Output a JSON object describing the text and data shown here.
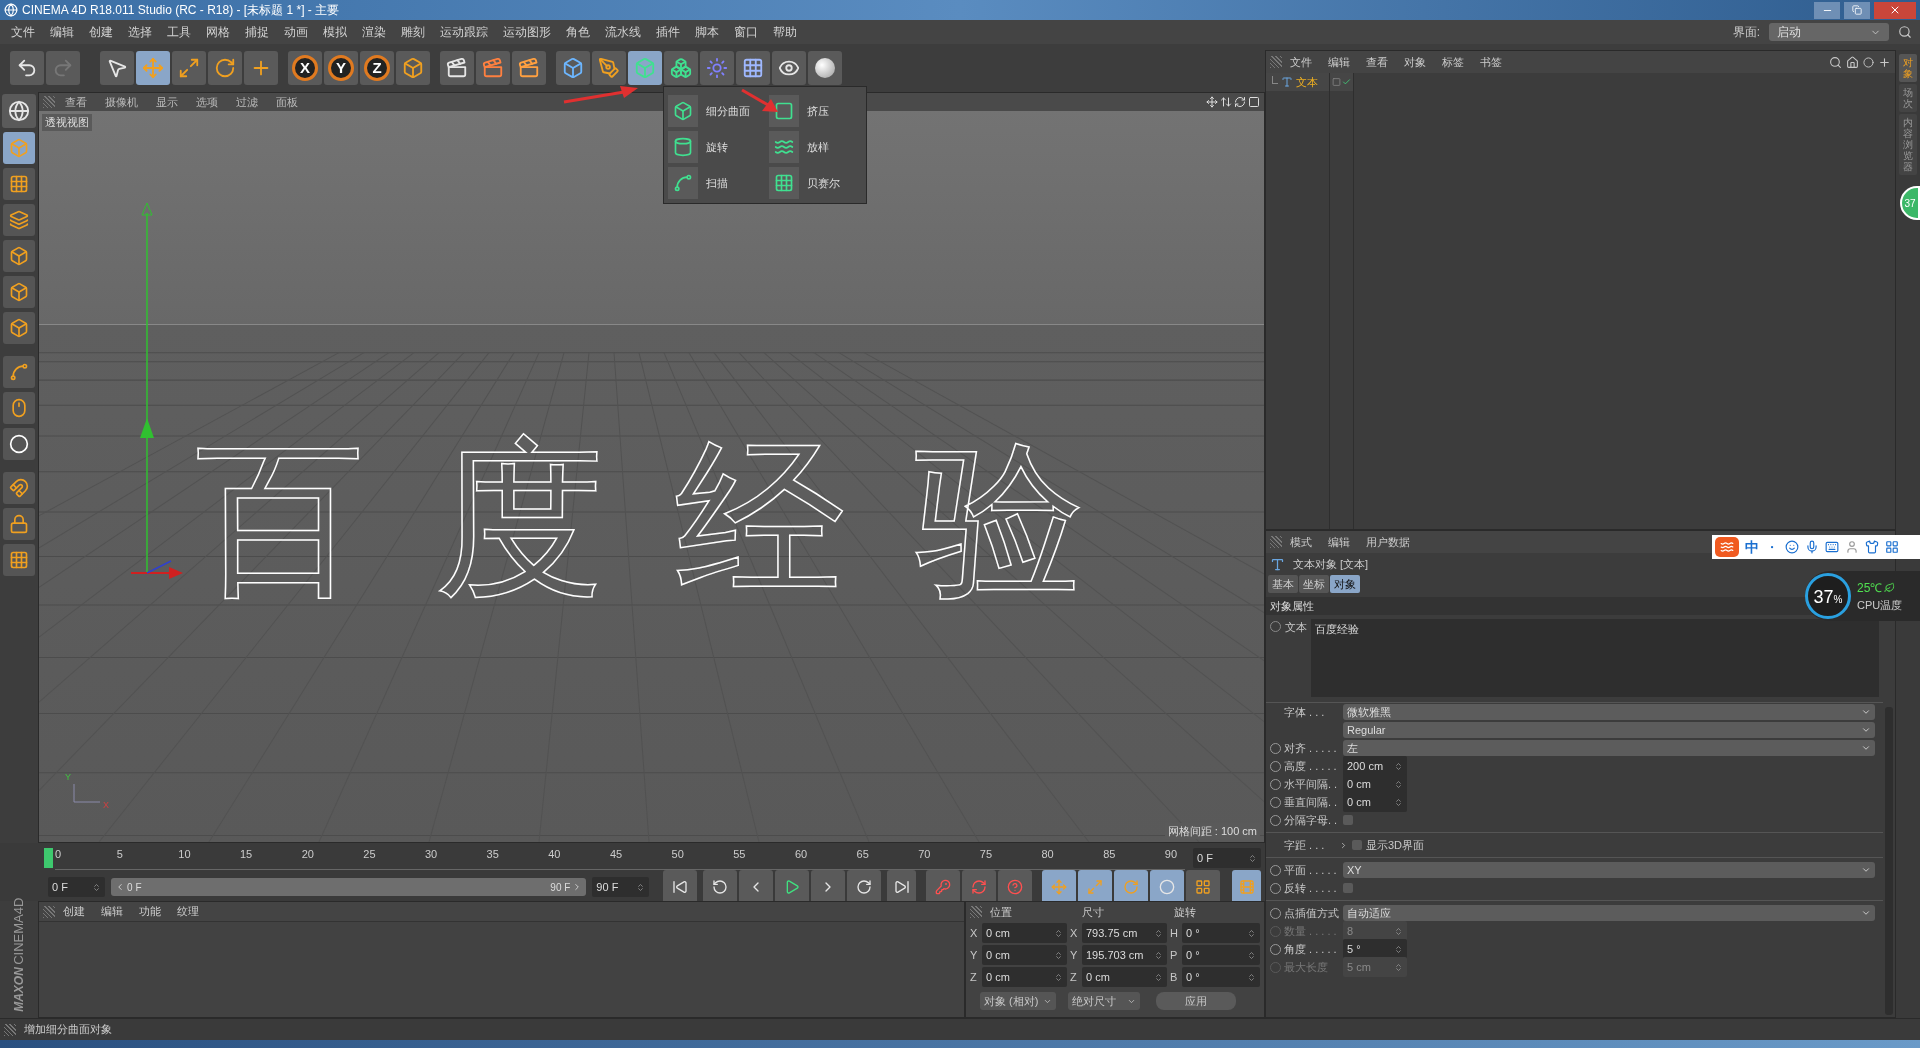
{
  "window": {
    "title": "CINEMA 4D R18.011 Studio (RC - R18) - [未标题 1 *] - 主要"
  },
  "menu_bar": {
    "items": [
      "文件",
      "编辑",
      "创建",
      "选择",
      "工具",
      "网格",
      "捕捉",
      "动画",
      "模拟",
      "渲染",
      "雕刻",
      "运动跟踪",
      "运动图形",
      "角色",
      "流水线",
      "插件",
      "脚本",
      "窗口",
      "帮助"
    ],
    "layout_label": "界面:",
    "layout_value": "启动"
  },
  "toolbar": {
    "axis_buttons": [
      "X",
      "Y",
      "Z"
    ]
  },
  "toolbar_popup": {
    "items": [
      {
        "label": "细分曲面"
      },
      {
        "label": "挤压"
      },
      {
        "label": "旋转"
      },
      {
        "label": "放样"
      },
      {
        "label": "扫描"
      },
      {
        "label": "贝赛尔"
      }
    ]
  },
  "viewport": {
    "menu": [
      "查看",
      "摄像机",
      "显示",
      "选项",
      "过滤",
      "面板"
    ],
    "label": "透视视图",
    "scene_text": "百度经验",
    "grid_spacing": "网格间距 : 100 cm",
    "gizmo": [
      "Y",
      "X"
    ]
  },
  "timeline": {
    "ticks": [
      "0",
      "5",
      "10",
      "15",
      "20",
      "25",
      "30",
      "35",
      "40",
      "45",
      "50",
      "55",
      "60",
      "65",
      "70",
      "75",
      "80",
      "85",
      "90"
    ],
    "current_frame": "0 F"
  },
  "transport": {
    "start": "0 F",
    "range_start": "0 F",
    "range_end": "90 F",
    "end": "90 F"
  },
  "material_manager": {
    "menu": [
      "创建",
      "编辑",
      "功能",
      "纹理"
    ]
  },
  "logo": {
    "brand": "MAXON",
    "product": "CINEMA4D"
  },
  "coordinates": {
    "headers": [
      "位置",
      "尺寸",
      "旋转"
    ],
    "rows": [
      {
        "pos_axis": "X",
        "pos": "0 cm",
        "size_axis": "X",
        "size": "793.75 cm",
        "rot_axis": "H",
        "rot": "0 °"
      },
      {
        "pos_axis": "Y",
        "pos": "0 cm",
        "size_axis": "Y",
        "size": "195.703 cm",
        "rot_axis": "P",
        "rot": "0 °"
      },
      {
        "pos_axis": "Z",
        "pos": "0 cm",
        "size_axis": "Z",
        "size": "0 cm",
        "rot_axis": "B",
        "rot": "0 °"
      }
    ],
    "mode": "对象 (相对)",
    "size_mode": "绝对尺寸",
    "apply": "应用"
  },
  "status_bar": {
    "text": "增加细分曲面对象"
  },
  "object_manager": {
    "menu": [
      "文件",
      "编辑",
      "查看",
      "对象",
      "标签",
      "书签"
    ],
    "objects": [
      {
        "name": "文本",
        "enabled": true
      }
    ]
  },
  "attributes": {
    "menu": [
      "模式",
      "编辑",
      "用户数据"
    ],
    "title": "文本对象 [文本]",
    "tabs": [
      {
        "label": "基本",
        "selected": false
      },
      {
        "label": "坐标",
        "selected": false
      },
      {
        "label": "对象",
        "selected": true
      }
    ],
    "section": "对象属性",
    "text_label": "文本",
    "text_value": "百度经验",
    "fields": [
      {
        "kind": "dropdown",
        "label": "字体 . . .",
        "value": "微软雅黑",
        "animatable": false,
        "disabled": false
      },
      {
        "kind": "dropdown",
        "value": "Regular",
        "animatable": false,
        "disabled": false
      },
      {
        "kind": "dropdown",
        "label": "对齐 . . . . .",
        "value": "左",
        "animatable": true,
        "disabled": false
      },
      {
        "kind": "number",
        "label": "高度 . . . . .",
        "value": "200 cm",
        "animatable": true,
        "disabled": false
      },
      {
        "kind": "number",
        "label": "水平间隔. .",
        "value": "0 cm",
        "animatable": true,
        "disabled": false
      },
      {
        "kind": "number",
        "label": "垂直间隔. .",
        "value": "0 cm",
        "animatable": true,
        "disabled": false
      },
      {
        "kind": "checkbox",
        "label": "分隔字母. .",
        "checked": false,
        "animatable": true,
        "disabled": false
      },
      {
        "kind": "separator"
      },
      {
        "kind": "expander",
        "label": "字距 . . .",
        "option": "显示3D界面",
        "checked": false,
        "animatable": false,
        "disabled": false
      },
      {
        "kind": "separator"
      },
      {
        "kind": "dropdown",
        "label": "平面 . . . . .",
        "value": "XY",
        "animatable": true,
        "disabled": false
      },
      {
        "kind": "checkbox",
        "label": "反转 . . . . .",
        "checked": false,
        "animatable": true,
        "disabled": false
      },
      {
        "kind": "separator"
      },
      {
        "kind": "dropdown",
        "label": "点插值方式",
        "value": "自动适应",
        "animatable": true,
        "disabled": false
      },
      {
        "kind": "number",
        "label": "数量 . . . . .",
        "value": "8",
        "animatable": true,
        "disabled": true
      },
      {
        "kind": "number",
        "label": "角度 . . . . .",
        "value": "5 °",
        "animatable": true,
        "disabled": false
      },
      {
        "kind": "number",
        "label": "最大长度",
        "value": "5 cm",
        "animatable": true,
        "disabled": true
      }
    ]
  },
  "side_tabs": [
    {
      "label": "对象",
      "selected": true
    },
    {
      "label": "场次",
      "selected": false
    },
    {
      "label": "内容浏览器",
      "selected": false
    }
  ],
  "overlays": {
    "ime_mode": "中",
    "cpu_usage": "37",
    "cpu_unit": "%",
    "cpu_temperature": "25℃",
    "cpu_label": "CPU温度",
    "edge_badge": "37"
  }
}
